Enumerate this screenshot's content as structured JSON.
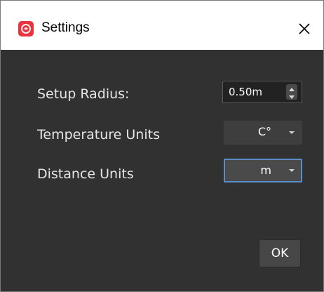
{
  "window": {
    "title": "Settings",
    "app_icon": "rose-icon",
    "close_icon": "close-icon"
  },
  "settings": {
    "setup_radius": {
      "label": "Setup Radius:",
      "value": "0.50m"
    },
    "temperature_units": {
      "label": "Temperature Units",
      "value": "C°"
    },
    "distance_units": {
      "label": "Distance Units",
      "value": "m"
    }
  },
  "buttons": {
    "ok_label": "OK"
  },
  "colors": {
    "accent": "#e8343f",
    "focus": "#5a8cc8",
    "background": "#313131"
  }
}
